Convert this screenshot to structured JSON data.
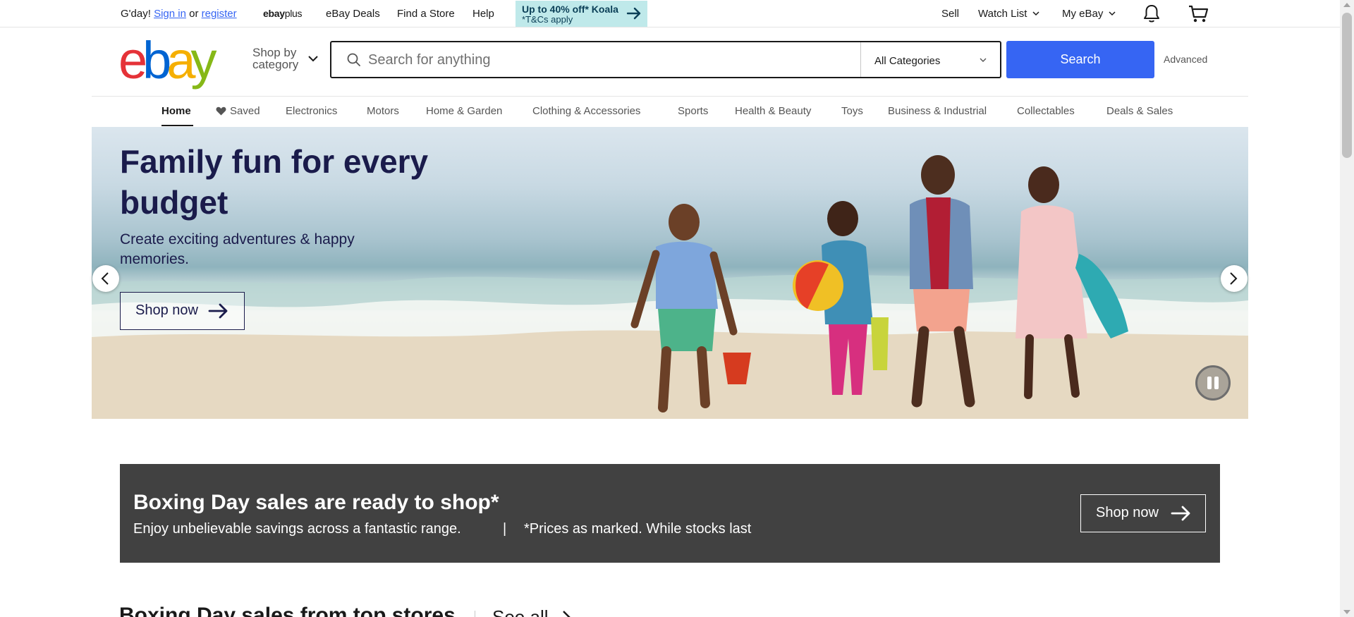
{
  "topbar": {
    "greeting": "G'day!",
    "sign_in": "Sign in",
    "or": "or",
    "register": "register",
    "ebayplus_a": "ebay",
    "ebayplus_b": "plus",
    "deals": "eBay Deals",
    "find_store": "Find a Store",
    "help": "Help",
    "promo_line1": "Up to 40% off* Koala",
    "promo_line2": "*T&Cs apply",
    "sell": "Sell",
    "watch_list": "Watch List",
    "my_ebay": "My eBay"
  },
  "header": {
    "logo": [
      "e",
      "b",
      "a",
      "y"
    ],
    "logo_colors": [
      "#e53238",
      "#0064d2",
      "#f5af02",
      "#86b817"
    ],
    "shop_by_line1": "Shop by",
    "shop_by_line2": "category",
    "search_placeholder": "Search for anything",
    "category_selected": "All Categories",
    "search_button": "Search",
    "advanced": "Advanced"
  },
  "nav": [
    "Home",
    "Saved",
    "Electronics",
    "Motors",
    "Home & Garden",
    "Clothing & Accessories",
    "Sports",
    "Health & Beauty",
    "Toys",
    "Business & Industrial",
    "Collectables",
    "Deals & Sales"
  ],
  "hero": {
    "title": "Family fun for every budget",
    "subtitle": "Create exciting adventures & happy memories.",
    "cta": "Shop now"
  },
  "banner": {
    "title": "Boxing Day sales are ready to shop*",
    "subtitle": "Enjoy unbelievable savings across a fantastic range.",
    "separator": "|",
    "note": "*Prices as marked. While stocks last",
    "cta": "Shop now"
  },
  "section": {
    "title": "Boxing Day sales from top stores",
    "see_all": "See all"
  },
  "colors": {
    "accent": "#3665f3",
    "hero_text": "#1a1b4b",
    "banner_bg": "#414141"
  }
}
